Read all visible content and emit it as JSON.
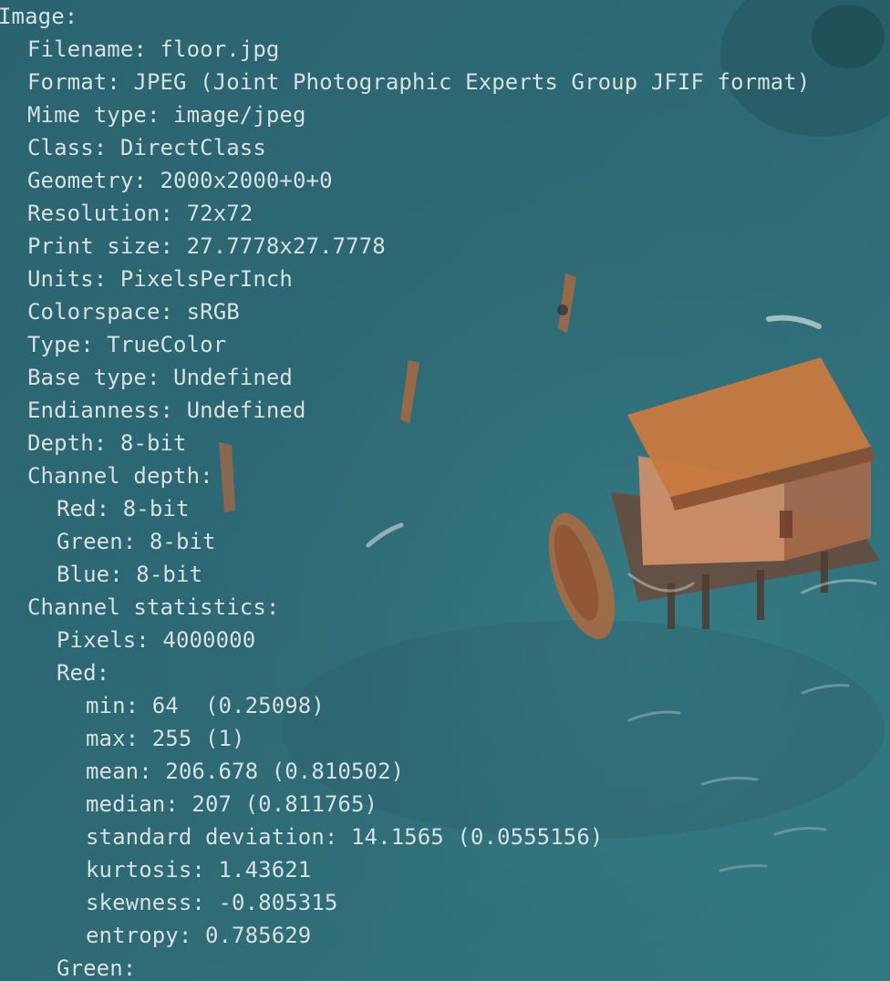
{
  "terminal": {
    "lines": [
      {
        "indent": 0,
        "text": "Image:"
      },
      {
        "indent": 1,
        "text": "Filename: floor.jpg"
      },
      {
        "indent": 1,
        "text": "Format: JPEG (Joint Photographic Experts Group JFIF format)"
      },
      {
        "indent": 1,
        "text": "Mime type: image/jpeg"
      },
      {
        "indent": 1,
        "text": "Class: DirectClass"
      },
      {
        "indent": 1,
        "text": "Geometry: 2000x2000+0+0"
      },
      {
        "indent": 1,
        "text": "Resolution: 72x72"
      },
      {
        "indent": 1,
        "text": "Print size: 27.7778x27.7778"
      },
      {
        "indent": 1,
        "text": "Units: PixelsPerInch"
      },
      {
        "indent": 1,
        "text": "Colorspace: sRGB"
      },
      {
        "indent": 1,
        "text": "Type: TrueColor"
      },
      {
        "indent": 1,
        "text": "Base type: Undefined"
      },
      {
        "indent": 1,
        "text": "Endianness: Undefined"
      },
      {
        "indent": 1,
        "text": "Depth: 8-bit"
      },
      {
        "indent": 1,
        "text": "Channel depth:"
      },
      {
        "indent": 2,
        "text": "Red: 8-bit"
      },
      {
        "indent": 2,
        "text": "Green: 8-bit"
      },
      {
        "indent": 2,
        "text": "Blue: 8-bit"
      },
      {
        "indent": 1,
        "text": "Channel statistics:"
      },
      {
        "indent": 2,
        "text": "Pixels: 4000000"
      },
      {
        "indent": 2,
        "text": "Red:"
      },
      {
        "indent": 3,
        "text": "min: 64  (0.25098)"
      },
      {
        "indent": 3,
        "text": "max: 255 (1)"
      },
      {
        "indent": 3,
        "text": "mean: 206.678 (0.810502)"
      },
      {
        "indent": 3,
        "text": "median: 207 (0.811765)"
      },
      {
        "indent": 3,
        "text": "standard deviation: 14.1565 (0.0555156)"
      },
      {
        "indent": 3,
        "text": "kurtosis: 1.43621"
      },
      {
        "indent": 3,
        "text": "skewness: -0.805315"
      },
      {
        "indent": 3,
        "text": "entropy: 0.785629"
      },
      {
        "indent": 2,
        "text": "Green:"
      }
    ]
  },
  "colors": {
    "text": "#d8e3e4",
    "background": "#2f6973",
    "roof": "#b8693a",
    "house_wall": "#e3a77c"
  }
}
